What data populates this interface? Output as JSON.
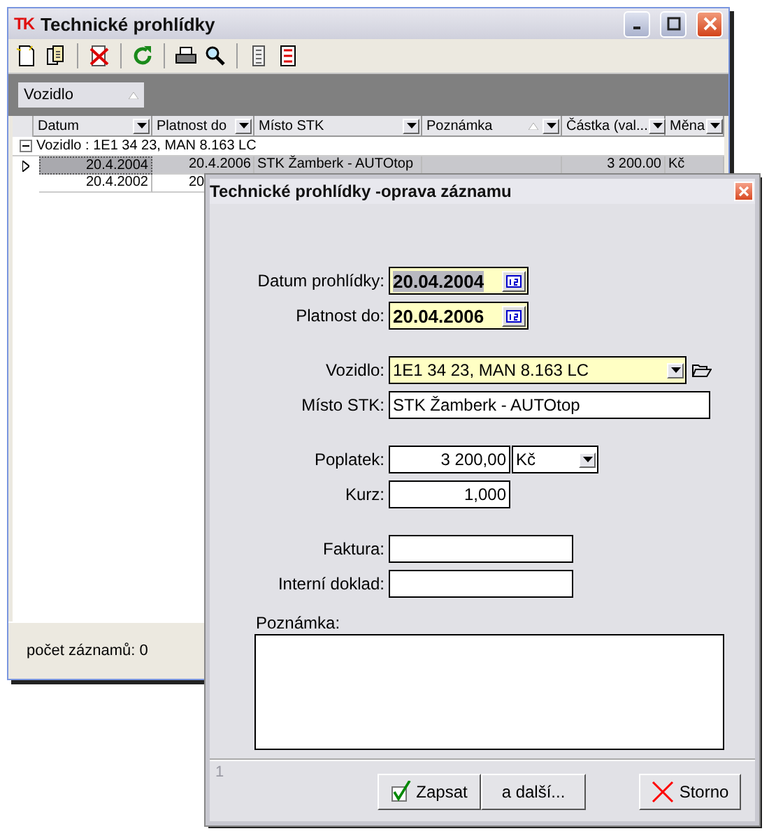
{
  "window": {
    "logo": "TK",
    "title": "Technické prohlídky"
  },
  "group_panel": {
    "chip": "Vozidlo"
  },
  "table": {
    "columns": [
      {
        "label": "Datum"
      },
      {
        "label": "Platnost do"
      },
      {
        "label": "Místo STK"
      },
      {
        "label": "Poznámka",
        "sorted": true
      },
      {
        "label": "Částka (val..."
      },
      {
        "label": "Měna"
      }
    ],
    "group_row": {
      "label": "Vozidlo : 1E1 34 23, MAN 8.163 LC",
      "expanded": true
    },
    "rows": [
      {
        "selected": true,
        "datum": "20.4.2004",
        "platnost_do": "20.4.2006",
        "misto_stk": "STK Žamberk - AUTOtop",
        "castka": "3 200.00",
        "mena": "Kč"
      },
      {
        "selected": false,
        "datum": "20.4.2002",
        "platnost_do": "20"
      }
    ]
  },
  "status_bar": "počet záznamů:  0",
  "dialog": {
    "title": "Technické prohlídky -oprava záznamu",
    "fields": [
      {
        "kind": "date",
        "label": "Datum prohlídky:",
        "value": "20.04.2004",
        "highlighted": true
      },
      {
        "kind": "date",
        "label": "Platnost do:",
        "value": "20.04.2006",
        "highlighted": false
      },
      {
        "kind": "vehicle",
        "label": "Vozidlo:",
        "value": "1E1 34 23, MAN 8.163 LC"
      },
      {
        "kind": "text",
        "label": "Místo STK:",
        "value": "STK Žamberk - AUTOtop"
      },
      {
        "kind": "amount",
        "label": "Poplatek:",
        "value": "3 200,00",
        "currency": "Kč"
      },
      {
        "kind": "number",
        "label": "Kurz:",
        "value": "1,000"
      },
      {
        "kind": "short",
        "label": "Faktura:"
      },
      {
        "kind": "short",
        "label": "Interní doklad:"
      }
    ],
    "note_label": "Poznámka:",
    "footer_status": "1",
    "buttons": [
      {
        "kind": "ok",
        "label": "Zapsat"
      },
      {
        "kind": "plain",
        "label": "a další..."
      },
      {
        "kind": "cancel",
        "label": "Storno"
      }
    ]
  }
}
